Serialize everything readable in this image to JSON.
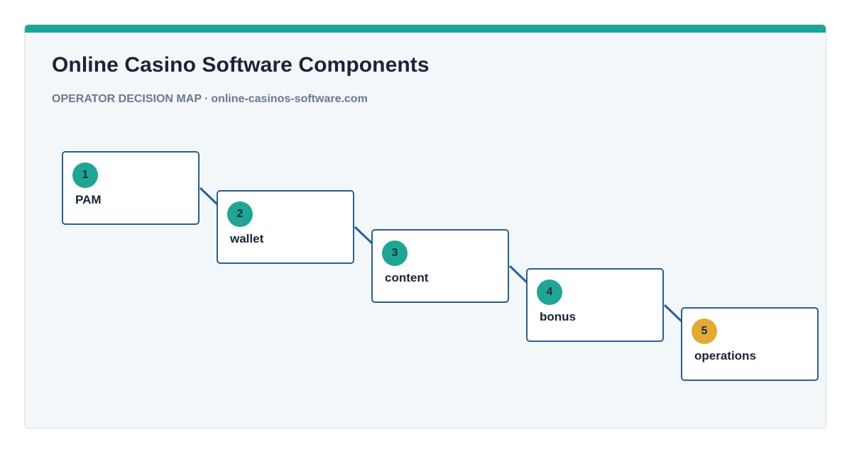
{
  "header": {
    "title": "Online Casino Software Components",
    "subtitle_lead": "OPERATOR DECISION MAP",
    "subtitle_separator": "·",
    "subtitle_domain": "online-casinos-software.com"
  },
  "colors": {
    "accent_bar": "#1fa594",
    "badge_default": "#1fa594",
    "badge_last": "#e3a933",
    "node_border": "#2a5f8f",
    "connector": "#2a5f8f"
  },
  "steps": [
    {
      "number": "1",
      "label": "PAM"
    },
    {
      "number": "2",
      "label": "wallet"
    },
    {
      "number": "3",
      "label": "content"
    },
    {
      "number": "4",
      "label": "bonus"
    },
    {
      "number": "5",
      "label": "operations"
    }
  ]
}
